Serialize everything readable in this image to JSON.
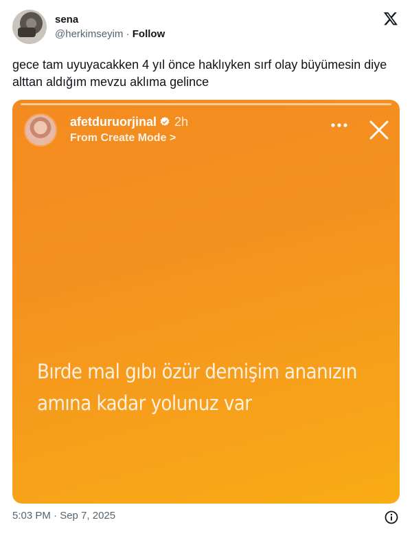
{
  "author": {
    "name": "sena",
    "handle": "@herkimseyim",
    "separator": "·",
    "follow_label": "Follow"
  },
  "tweet": {
    "text": "gece tam uyuyacakken 4 yıl önce haklıyken sırf olay büyümesin diye alttan aldığım mevzu aklıma gelince",
    "timestamp": "5:03 PM · Sep 7, 2025"
  },
  "story": {
    "username": "afetduruorjinal",
    "time_ago": "2h",
    "subtitle": "From Create Mode >",
    "text_line1": "Bırde mal gıbı özür demişim ananızın",
    "text_line2": "amına kadar yolunuz var",
    "background_colors": [
      "#f38a20",
      "#f9ac14"
    ]
  },
  "icons": {
    "brand": "x-logo-icon",
    "verified": "verified-badge-icon",
    "more": "more-dots-icon",
    "close": "close-icon",
    "info": "info-icon"
  }
}
